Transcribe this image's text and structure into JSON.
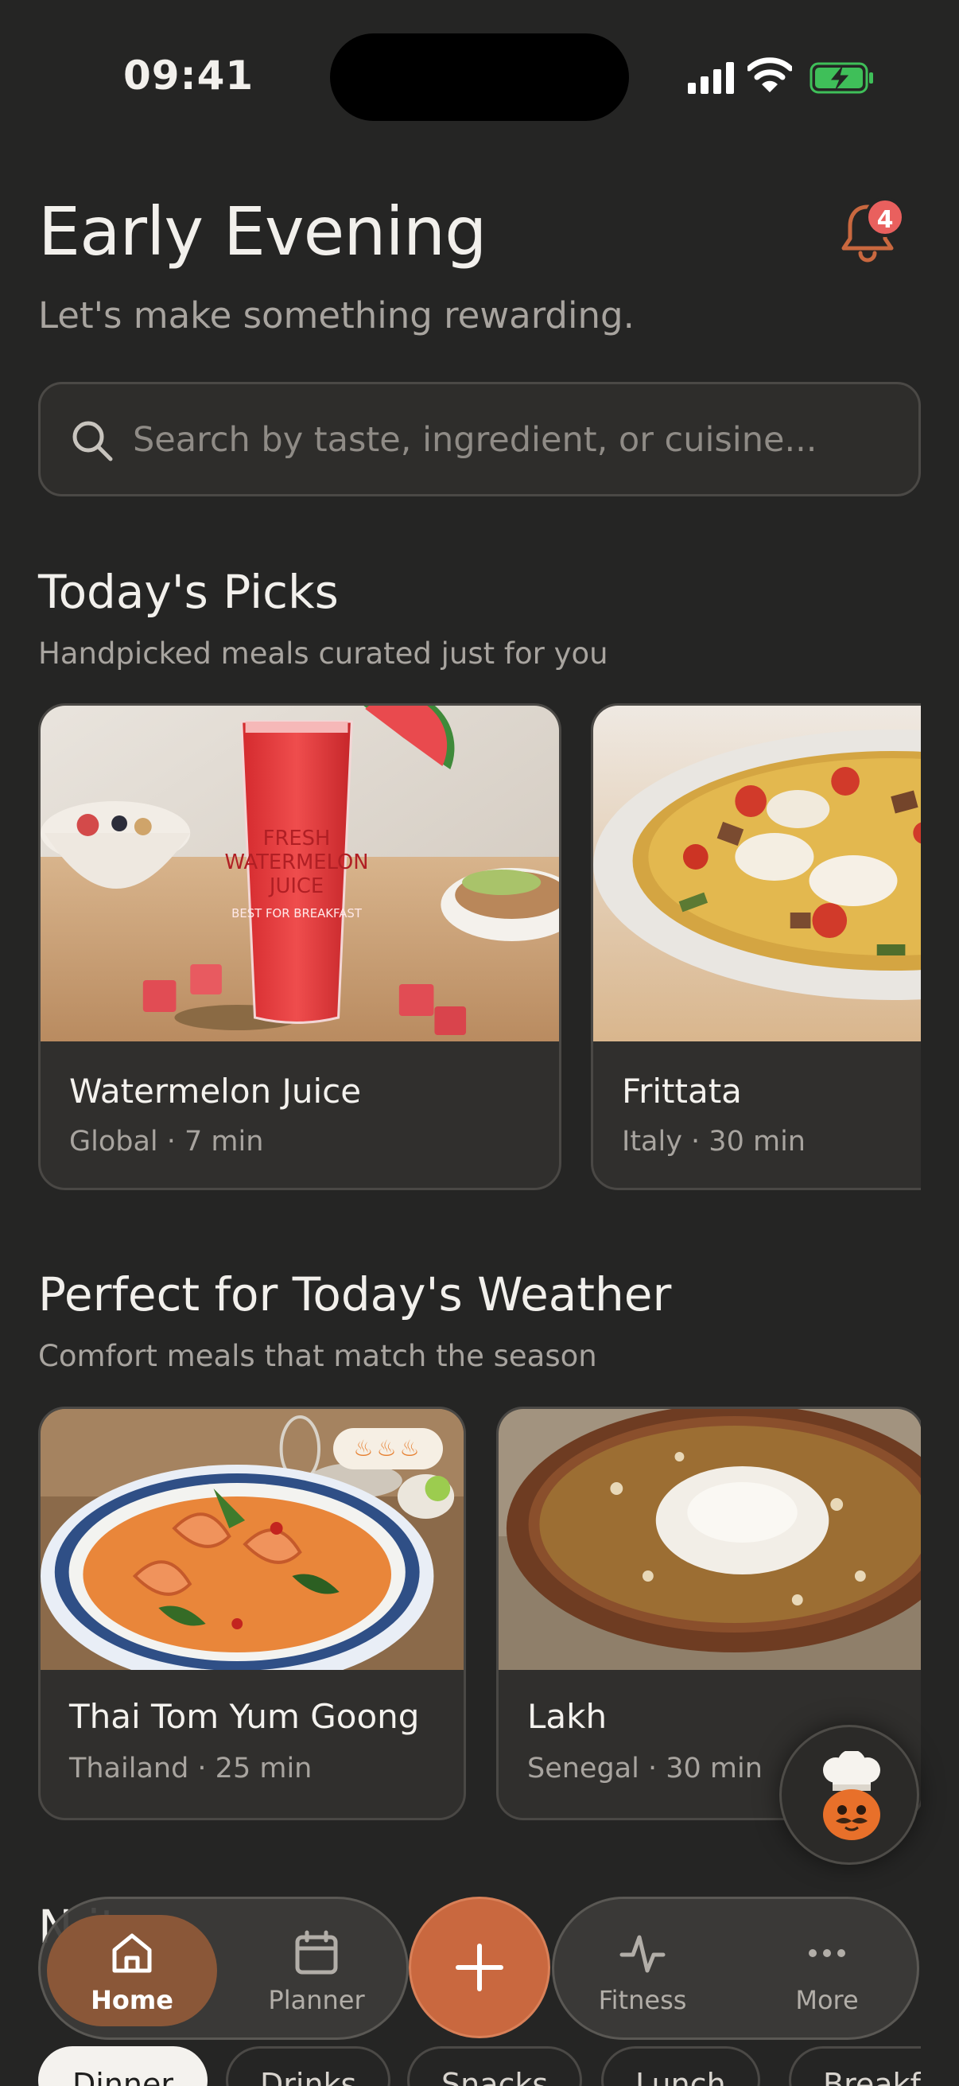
{
  "status_bar": {
    "time": "09:41"
  },
  "header": {
    "greeting": "Early Evening",
    "subtitle": "Let's make something rewarding.",
    "notification_count": "4"
  },
  "search": {
    "placeholder": "Search by taste, ingredient, or cuisine..."
  },
  "todays_picks": {
    "title": "Today's Picks",
    "subtitle": "Handpicked meals curated just for you",
    "items": [
      {
        "name": "Watermelon Juice",
        "meta": "Global · 7 min",
        "image_text": [
          "FRESH",
          "WATERMELON",
          "JUICE",
          "BEST FOR BREAKFAST"
        ]
      },
      {
        "name": "Frittata",
        "meta": "Italy · 30 min"
      }
    ]
  },
  "weather": {
    "title": "Perfect for Today's Weather",
    "subtitle": "Comfort meals that match the season",
    "items": [
      {
        "name": "Thai Tom Yum Goong",
        "meta": "Thailand · 25 min",
        "spice_level": 3
      },
      {
        "name": "Lakh",
        "meta": "Senegal · 30 min"
      }
    ]
  },
  "next_section": {
    "title_partial": "N                    it"
  },
  "nav": {
    "items": [
      {
        "label": "Home",
        "icon": "home-icon",
        "active": true
      },
      {
        "label": "Planner",
        "icon": "calendar-icon"
      },
      {
        "label": "Fitness",
        "icon": "activity-icon"
      },
      {
        "label": "More",
        "icon": "more-icon"
      }
    ],
    "fab_icon": "plus-icon"
  },
  "chips": [
    "Dinner",
    "Drinks",
    "Snacks",
    "Lunch",
    "Breakfast"
  ],
  "colors": {
    "accent": "#c9683f",
    "background": "#252524",
    "card": "#302f2d",
    "badge": "#e9605e"
  }
}
